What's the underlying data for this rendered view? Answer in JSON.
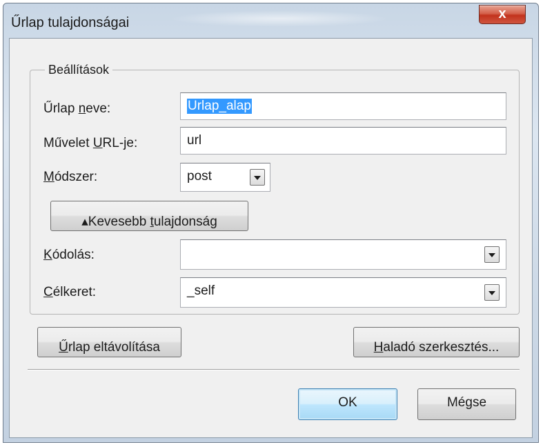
{
  "window": {
    "title": "Űrlap tulajdonságai",
    "close_symbol": "x",
    "close_icon": "close-icon"
  },
  "settings_group": {
    "legend": "Beállítások"
  },
  "form_name": {
    "label_pre": "Űrlap ",
    "label_accel": "n",
    "label_post": "eve:",
    "value": "Urlap_alap",
    "value_selected": true
  },
  "action_url": {
    "label_pre": "Művelet ",
    "label_accel": "U",
    "label_post": "RL-je:",
    "value": "url"
  },
  "method": {
    "label_pre": "",
    "label_accel": "M",
    "label_post": "ódszer:",
    "value": "post"
  },
  "less_properties_button": {
    "label_pre": "▴Kevesebb ",
    "label_accel": "t",
    "label_post": "ulajdonság"
  },
  "encoding": {
    "label_pre": "",
    "label_accel": "K",
    "label_post": "ódolás:",
    "value": ""
  },
  "target": {
    "label_pre": "",
    "label_accel": "C",
    "label_post": "élkeret:",
    "value": "_self"
  },
  "remove_form_button": {
    "label_pre": "",
    "label_accel": "Ű",
    "label_post": "rlap eltávolítása"
  },
  "advanced_edit_button": {
    "label_pre": "",
    "label_accel": "H",
    "label_post": "aladó szerkesztés..."
  },
  "ok_button": {
    "label": "OK"
  },
  "cancel_button": {
    "label": "Mégse"
  },
  "colors": {
    "selection": "#3399ff",
    "default_button_border": "#3c7fb1",
    "close_button": "#c2331d"
  }
}
